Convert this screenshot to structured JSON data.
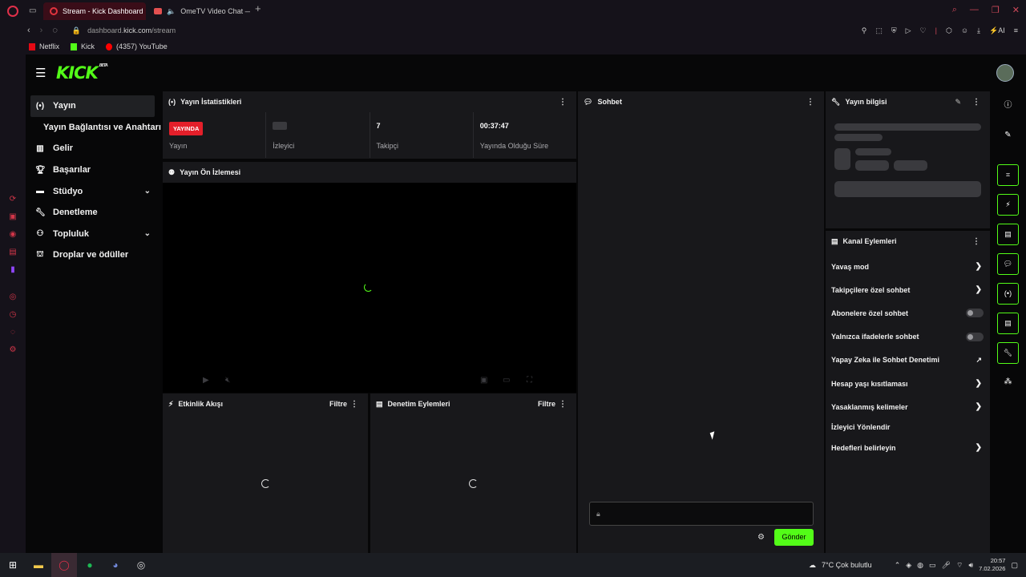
{
  "browser": {
    "tabs": [
      {
        "label": "Stream - Kick Dashboard",
        "active": true
      },
      {
        "label": "OmeTV Video Chat —",
        "active": false
      }
    ],
    "new_tab": "+",
    "url_host": "dashboard.",
    "url_domain": "kick.com",
    "url_path": "/stream",
    "ai_label": "AI",
    "bookmarks": [
      "Netflix",
      "Kick",
      "(4357) YouTube"
    ]
  },
  "app": {
    "logo": "KICK",
    "logo_badge": "BETA",
    "sidebar": [
      {
        "label": "Yayın",
        "icon": "broadcast-icon"
      },
      {
        "label": "Yayın Bağlantısı ve Anahtarı",
        "icon": ""
      },
      {
        "label": "Gelir",
        "icon": "chart-icon"
      },
      {
        "label": "Başarılar",
        "icon": "trophy-icon"
      },
      {
        "label": "Stüdyo",
        "icon": "studio-icon"
      },
      {
        "label": "Denetleme",
        "icon": "wrench-icon"
      },
      {
        "label": "Topluluk",
        "icon": "community-icon"
      },
      {
        "label": "Droplar ve ödüller",
        "icon": "gift-icon"
      }
    ],
    "stats": {
      "title": "Yayın İstatistikleri",
      "live_badge": "YAYINDA",
      "stream_label": "Yayın",
      "viewers_label": "İzleyici",
      "followers_value": "7",
      "followers_label": "Takipçi",
      "uptime_value": "00:37:47",
      "uptime_label": "Yayında Olduğu Süre"
    },
    "preview_title": "Yayın Ön İzlemesi",
    "activity": {
      "title": "Etkinlik Akışı",
      "filter": "Filtre"
    },
    "moderation": {
      "title": "Denetim Eylemleri",
      "filter": "Filtre"
    },
    "chat": {
      "title": "Sohbet",
      "send": "Gönder"
    },
    "stream_info": {
      "title": "Yayın bilgisi"
    },
    "channel_actions": {
      "title": "Kanal Eylemleri",
      "items": [
        {
          "label": "Yavaş mod",
          "control": "chevron"
        },
        {
          "label": "Takipçilere özel sohbet",
          "control": "chevron"
        },
        {
          "label": "Abonelere özel sohbet",
          "control": "toggle"
        },
        {
          "label": "Yalnızca ifadelerle sohbet",
          "control": "toggle"
        },
        {
          "label": "Yapay Zeka ile Sohbet Denetimi",
          "control": "external"
        },
        {
          "label": "Hesap yaşı kısıtlaması",
          "control": "chevron"
        },
        {
          "label": "Yasaklanmış kelimeler",
          "control": "chevron"
        },
        {
          "label": "İzleyici Yönlendir",
          "control": "none"
        },
        {
          "label": "Hedefleri belirleyin",
          "control": "chevron"
        }
      ]
    }
  },
  "taskbar": {
    "weather": "7°C  Çok bulutlu",
    "time": "20:57",
    "date": "7.02.2026"
  },
  "colors": {
    "accent": "#53fc18",
    "live": "#e41f2a",
    "panel": "#18181b"
  }
}
